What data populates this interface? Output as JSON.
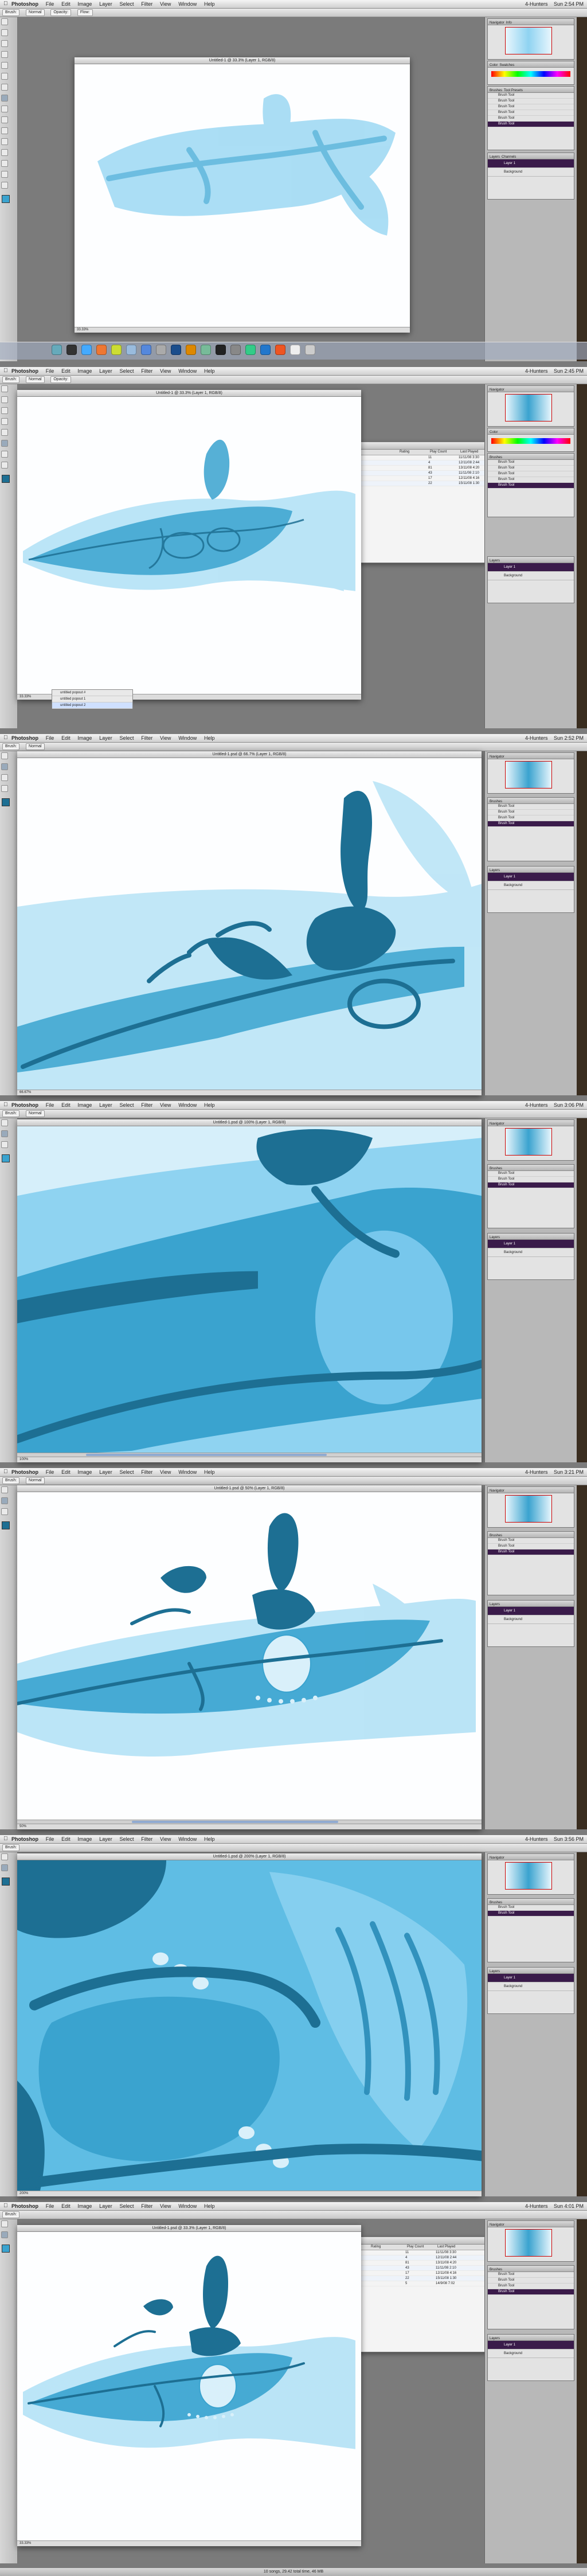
{
  "menubar": {
    "apple": "",
    "app": "Photoshop",
    "items": [
      "File",
      "Edit",
      "Image",
      "Layer",
      "Select",
      "Filter",
      "View",
      "Window",
      "Help"
    ]
  },
  "options": [
    "Brush:",
    "Mode:",
    "Normal",
    "Opacity:",
    "Flow:",
    "Airbrush"
  ],
  "frames": [
    {
      "doc_title": "Untitled-1 @ 33.3% (Layer 1, RGB/8)",
      "status": "33.33%",
      "time": "Sun 2:54 PM",
      "user": "4-Hunters"
    },
    {
      "doc_title": "Untitled-1 @ 33.3% (Layer 1, RGB/8)",
      "status": "33.33%",
      "time": "Sun 2:45 PM",
      "user": "4-Hunters"
    },
    {
      "doc_title": "Untitled-1.psd @ 66.7% (Layer 1, RGB/8)",
      "status": "66.67%",
      "time": "Sun 2:52 PM",
      "user": "4-Hunters"
    },
    {
      "doc_title": "Untitled-1.psd @ 100% (Layer 1, RGB/8)",
      "status": "100%",
      "time": "Sun 3:06 PM",
      "user": "4-Hunters"
    },
    {
      "doc_title": "Untitled-1.psd @ 50% (Layer 1, RGB/8)",
      "status": "50%",
      "time": "Sun 3:21 PM",
      "user": "4-Hunters"
    },
    {
      "doc_title": "Untitled-1.psd @ 200% (Layer 1, RGB/8)",
      "status": "200%",
      "time": "Sun 3:56 PM",
      "user": "4-Hunters"
    },
    {
      "doc_title": "Untitled-1.psd @ 33.3% (Layer 1, RGB/8)",
      "status": "33.33%",
      "time": "Sun 4:01 PM",
      "user": "4-Hunters"
    }
  ],
  "panels": {
    "navigator_tabs": [
      "Navigator",
      "Info",
      "Histogram"
    ],
    "color_tabs": [
      "Color",
      "Swatches",
      "Styles"
    ],
    "brushes_tabs": [
      "Brushes",
      "Tool Presets",
      "Clone Source"
    ],
    "brush_list": [
      "Brush Tool",
      "Brush Tool",
      "Brush Tool",
      "Brush Tool",
      "Brush Tool",
      "Brush Tool"
    ],
    "brush_selected": "Brush Tool",
    "layers_tabs": [
      "Layers",
      "Channels",
      "Paths"
    ],
    "layers": [
      "Layer 1",
      "Background"
    ]
  },
  "itunes": {
    "columns": [
      "Rating",
      "Play Count",
      "Last Played"
    ],
    "rows": [
      {
        "name": "",
        "count": "11",
        "last": "11/11/08 3:30"
      },
      {
        "name": "",
        "count": "4",
        "last": "12/11/08 2:44"
      },
      {
        "name": "",
        "count": "81",
        "last": "13/11/08 4:20"
      },
      {
        "name": "",
        "count": "43",
        "last": "11/11/08 2:10"
      },
      {
        "name": "",
        "count": "17",
        "last": "12/11/08 4:16"
      },
      {
        "name": "",
        "count": "22",
        "last": "15/11/08 1:30"
      },
      {
        "name": "",
        "count": "5",
        "last": "14/9/08 7:02"
      }
    ]
  },
  "sheet_rows": [
    "untitled popout #",
    "untitled popout 1",
    "untitled popout 2"
  ],
  "bottom_status": "10 songs, 29.42 total time, 46 MB",
  "colors": {
    "paint_dark": "#1d6f93",
    "paint_mid": "#3aa3cf",
    "paint_light": "#8fd3f1",
    "select": "#3a1b4a"
  }
}
